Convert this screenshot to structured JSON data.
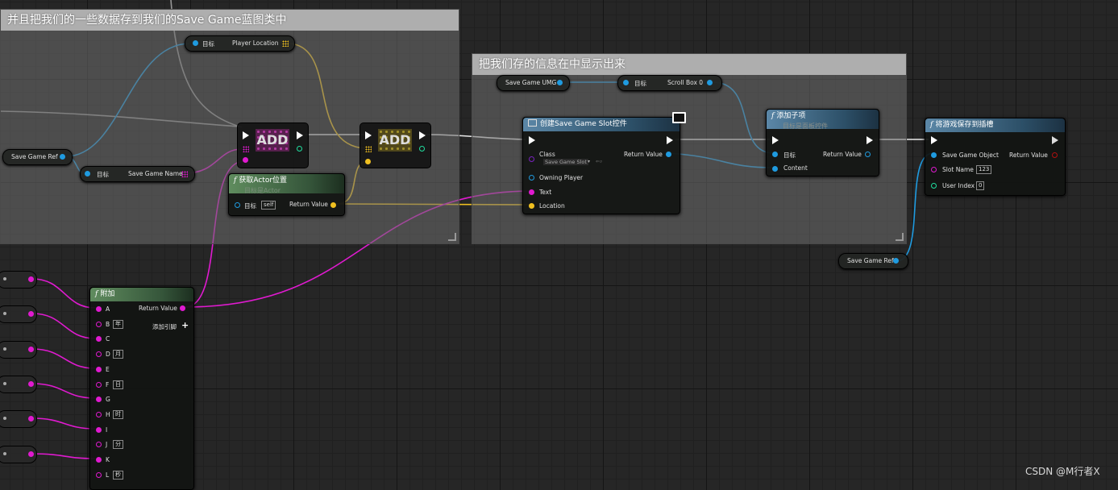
{
  "comments": {
    "save_data": "并且把我们的一些数据存到我们的Save Game蓝图类中",
    "display_info": "把我们存的信息在中显示出来"
  },
  "nodes": {
    "get_player_location": {
      "target": "目标",
      "output": "Player Location"
    },
    "save_game_ref_left": {
      "label": "Save Game Ref"
    },
    "set_save_game_name": {
      "target": "目标",
      "output": "Save Game Name"
    },
    "add_1": {
      "label": "ADD"
    },
    "add_2": {
      "label": "ADD"
    },
    "get_actor_location": {
      "title": "获取Actor位置",
      "subtitle": "目标是Actor",
      "target": "目标",
      "self_value": "self",
      "return": "Return Value"
    },
    "save_game_umg": {
      "label": "Save Game UMG"
    },
    "scroll_box": {
      "target": "目标",
      "output": "Scroll Box 0"
    },
    "create_widget": {
      "title": "创建Save Game Slot控件",
      "class": "Class",
      "class_value": "Save Game Slot",
      "return": "Return Value",
      "owning_player": "Owning Player",
      "text": "Text",
      "location": "Location"
    },
    "add_child": {
      "title": "添加子项",
      "subtitle": "目标是面板控件",
      "target": "目标",
      "return": "Return Value",
      "content": "Content"
    },
    "save_game_to_slot": {
      "title": "将游戏保存到插槽",
      "object": "Save Game Object",
      "return": "Return Value",
      "slot_name": "Slot Name",
      "slot_value": "123",
      "user_index": "User Index",
      "user_value": "0"
    },
    "save_game_ref_right": {
      "label": "Save Game Ref"
    },
    "append": {
      "title": "附加",
      "return": "Return Value",
      "add_pin": "添加引脚",
      "pins": [
        {
          "name": "A",
          "value": ""
        },
        {
          "name": "B",
          "value": "年"
        },
        {
          "name": "C",
          "value": ""
        },
        {
          "name": "D",
          "value": "月"
        },
        {
          "name": "E",
          "value": ""
        },
        {
          "name": "F",
          "value": "日"
        },
        {
          "name": "G",
          "value": ""
        },
        {
          "name": "H",
          "value": "时"
        },
        {
          "name": "I",
          "value": ""
        },
        {
          "name": "J",
          "value": "分"
        },
        {
          "name": "K",
          "value": ""
        },
        {
          "name": "L",
          "value": "秒"
        }
      ]
    }
  },
  "watermark": "CSDN @M行者X",
  "colors": {
    "exec": "#ffffff",
    "object": "#18a0e8",
    "string": "#e000c8",
    "vector": "#f0c020",
    "name": "#c89bff",
    "class": "#6a00a0",
    "int": "#20e0a0",
    "controller": "#18a0e8"
  }
}
